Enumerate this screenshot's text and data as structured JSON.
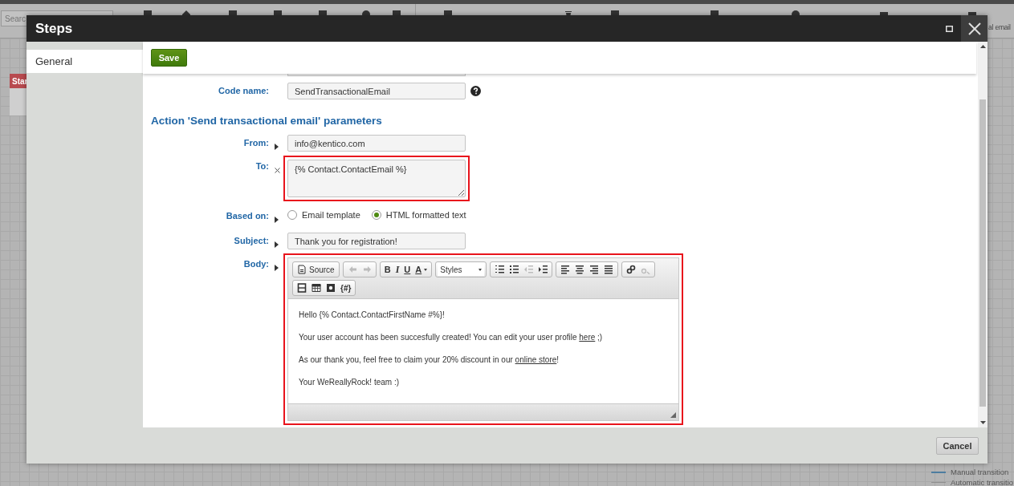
{
  "background": {
    "search_placeholder": "Searc",
    "node_label": "Star",
    "step_label": "al email",
    "legend": [
      {
        "kind": "manual",
        "label": "Manual transition"
      },
      {
        "kind": "automatic",
        "label": "Automatic transitio"
      }
    ]
  },
  "dialog": {
    "title": "Steps",
    "sidebar": {
      "items": [
        {
          "label": "General",
          "selected": true
        }
      ]
    },
    "save_button": "Save",
    "code_name": {
      "label": "Code name:",
      "value": "SendTransactionalEmail"
    },
    "section_title": "Action 'Send transactional email' parameters",
    "fields": [
      {
        "kind": "text",
        "label": "From:",
        "macro": false,
        "highlighted": false,
        "value": "info@kentico.com"
      },
      {
        "kind": "textarea",
        "label": "To:",
        "macro": true,
        "highlighted": true,
        "value": "{% Contact.ContactEmail %}"
      },
      {
        "kind": "radio",
        "label": "Based on:",
        "macro": false,
        "highlighted": false,
        "options": [
          {
            "label": "Email template",
            "selected": false
          },
          {
            "label": "HTML formatted text",
            "selected": true
          }
        ]
      },
      {
        "kind": "text",
        "label": "Subject:",
        "macro": false,
        "highlighted": false,
        "value": "Thank you for registration!"
      },
      {
        "kind": "editor",
        "label": "Body:",
        "macro": false,
        "highlighted": true,
        "toolbar_rows": [
          [
            [
              {
                "kind": "source",
                "label": "Source",
                "disabled": false
              }
            ],
            [
              {
                "kind": "undo",
                "disabled": true
              },
              {
                "kind": "redo",
                "disabled": true
              }
            ],
            [
              {
                "kind": "bold",
                "label": "B",
                "disabled": false
              },
              {
                "kind": "italic",
                "label": "I",
                "disabled": false
              },
              {
                "kind": "underline",
                "label": "U",
                "disabled": false
              },
              {
                "kind": "text-color",
                "label": "A",
                "disabled": false
              }
            ],
            [
              {
                "kind": "styles",
                "label": "Styles",
                "disabled": false
              }
            ],
            [
              {
                "kind": "ordered-list",
                "disabled": false
              },
              {
                "kind": "bullet-list",
                "disabled": false
              },
              {
                "kind": "outdent",
                "disabled": true
              },
              {
                "kind": "indent",
                "disabled": false
              }
            ],
            [
              {
                "kind": "align-left",
                "disabled": false
              },
              {
                "kind": "align-center",
                "disabled": false
              },
              {
                "kind": "align-right",
                "disabled": false
              },
              {
                "kind": "justify",
                "disabled": false
              }
            ],
            [
              {
                "kind": "link",
                "disabled": false
              },
              {
                "kind": "unlink",
                "disabled": true
              }
            ]
          ],
          [
            [
              {
                "kind": "page-break",
                "disabled": false
              },
              {
                "kind": "table",
                "disabled": false
              },
              {
                "kind": "special",
                "disabled": false
              },
              {
                "kind": "macro",
                "label": "{#}",
                "disabled": false
              }
            ]
          ]
        ],
        "paragraphs": [
          [
            {
              "text": "Hello {% Contact.ContactFirstName #%}!",
              "link": false
            }
          ],
          [
            {
              "text": "Your user account has been succesfully created! You can edit your user profile ",
              "link": false
            },
            {
              "text": "here",
              "link": true
            },
            {
              "text": " ;)",
              "link": false
            }
          ],
          [
            {
              "text": "As our thank you, feel free to claim your 20% discount in our ",
              "link": false
            },
            {
              "text": "online store",
              "link": true
            },
            {
              "text": "!",
              "link": false
            }
          ],
          [
            {
              "text": "Your WeReallyRock! team :)",
              "link": false
            }
          ]
        ]
      }
    ],
    "cancel_button": "Cancel"
  }
}
